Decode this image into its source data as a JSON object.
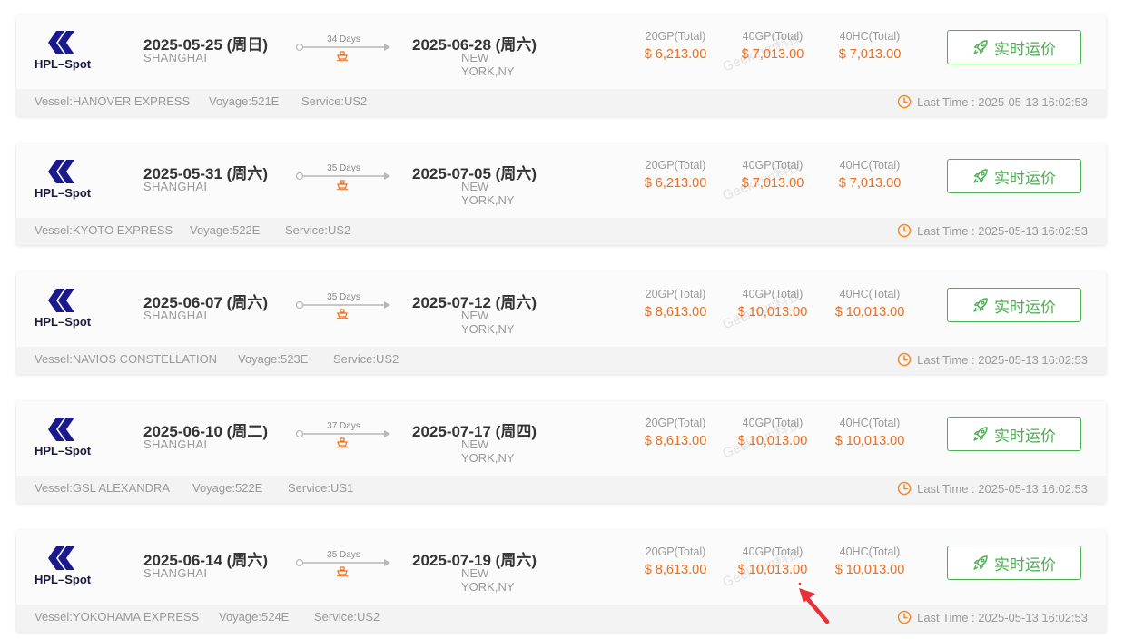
{
  "colors": {
    "price": "#ef6c1c",
    "button_green": "#4caf50",
    "muted": "#999999",
    "logo_navy": "#1a1a8c",
    "clock_orange": "#f08a24",
    "annotation_red": "#e8303a"
  },
  "icons": {
    "logo": "hapag-lloyd-logo",
    "ship": "ship-icon",
    "rocket": "rocket-icon",
    "clock": "clock-icon",
    "arrow": "arrow-line-icon"
  },
  "watermark": "GeekYun科技",
  "cards": [
    {
      "carrier": "HPL–Spot",
      "depart_date": "2025-05-25 (周日)",
      "depart_port": "SHANGHAI",
      "days": "34 Days",
      "arrive_date": "2025-06-28 (周六)",
      "arrive_port": "NEW YORK,NY",
      "labels": [
        "20GP(Total)",
        "40GP(Total)",
        "40HC(Total)"
      ],
      "prices": [
        "$ 6,213.00",
        "$ 7,013.00",
        "$ 7,013.00"
      ],
      "button": "实时运价",
      "vessel": "Vessel:HANOVER EXPRESS",
      "voyage": "Voyage:521E",
      "service": "Service:US2",
      "last_time": "Last Time : 2025-05-13 16:02:53"
    },
    {
      "carrier": "HPL–Spot",
      "depart_date": "2025-05-31 (周六)",
      "depart_port": "SHANGHAI",
      "days": "35 Days",
      "arrive_date": "2025-07-05 (周六)",
      "arrive_port": "NEW YORK,NY",
      "labels": [
        "20GP(Total)",
        "40GP(Total)",
        "40HC(Total)"
      ],
      "prices": [
        "$ 6,213.00",
        "$ 7,013.00",
        "$ 7,013.00"
      ],
      "button": "实时运价",
      "vessel": "Vessel:KYOTO EXPRESS",
      "voyage": "Voyage:522E",
      "service": "Service:US2",
      "last_time": "Last Time : 2025-05-13 16:02:53"
    },
    {
      "carrier": "HPL–Spot",
      "depart_date": "2025-06-07 (周六)",
      "depart_port": "SHANGHAI",
      "days": "35 Days",
      "arrive_date": "2025-07-12 (周六)",
      "arrive_port": "NEW YORK,NY",
      "labels": [
        "20GP(Total)",
        "40GP(Total)",
        "40HC(Total)"
      ],
      "prices": [
        "$ 8,613.00",
        "$ 10,013.00",
        "$ 10,013.00"
      ],
      "button": "实时运价",
      "vessel": "Vessel:NAVIOS CONSTELLATION",
      "voyage": "Voyage:523E",
      "service": "Service:US2",
      "last_time": "Last Time : 2025-05-13 16:02:53"
    },
    {
      "carrier": "HPL–Spot",
      "depart_date": "2025-06-10 (周二)",
      "depart_port": "SHANGHAI",
      "days": "37 Days",
      "arrive_date": "2025-07-17 (周四)",
      "arrive_port": "NEW YORK,NY",
      "labels": [
        "20GP(Total)",
        "40GP(Total)",
        "40HC(Total)"
      ],
      "prices": [
        "$ 8,613.00",
        "$ 10,013.00",
        "$ 10,013.00"
      ],
      "button": "实时运价",
      "vessel": "Vessel:GSL ALEXANDRA",
      "voyage": "Voyage:522E",
      "service": "Service:US1",
      "last_time": "Last Time : 2025-05-13 16:02:53"
    },
    {
      "carrier": "HPL–Spot",
      "depart_date": "2025-06-14 (周六)",
      "depart_port": "SHANGHAI",
      "days": "35 Days",
      "arrive_date": "2025-07-19 (周六)",
      "arrive_port": "NEW YORK,NY",
      "labels": [
        "20GP(Total)",
        "40GP(Total)",
        "40HC(Total)"
      ],
      "prices": [
        "$ 8,613.00",
        "$ 10,013.00",
        "$ 10,013.00"
      ],
      "button": "实时运价",
      "vessel": "Vessel:YOKOHAMA EXPRESS",
      "voyage": "Voyage:524E",
      "service": "Service:US2",
      "last_time": "Last Time : 2025-05-13 16:02:53"
    }
  ]
}
